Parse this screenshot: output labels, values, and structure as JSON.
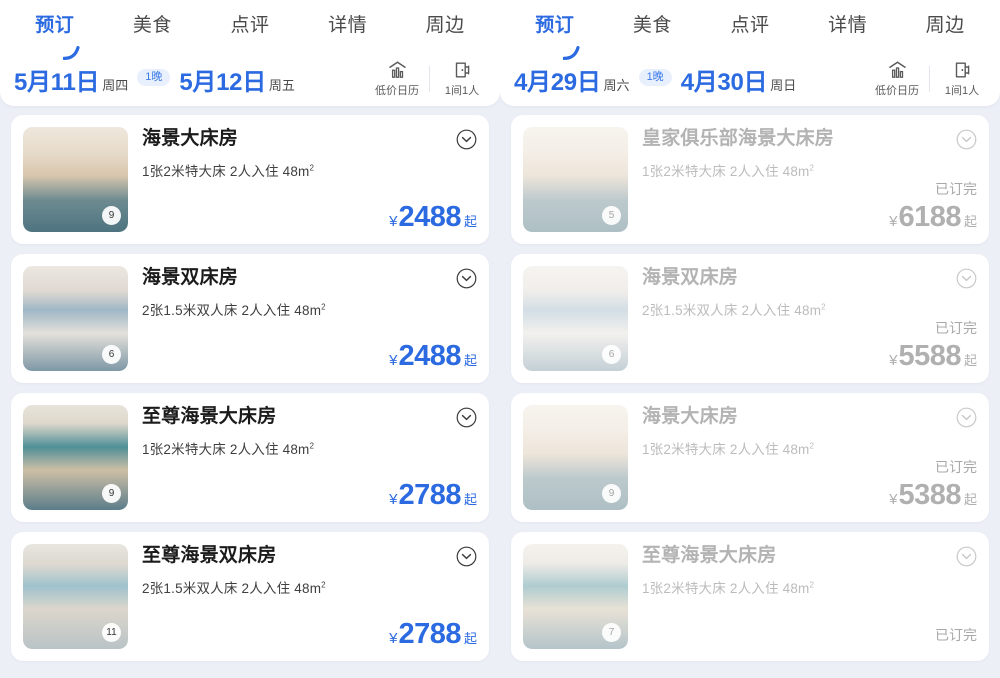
{
  "panels": [
    {
      "id": "left",
      "tabs": [
        {
          "label": "预订",
          "active": true
        },
        {
          "label": "美食",
          "active": false
        },
        {
          "label": "点评",
          "active": false
        },
        {
          "label": "详情",
          "active": false
        },
        {
          "label": "周边",
          "active": false
        }
      ],
      "dates": {
        "checkin_date": "5月11日",
        "checkin_week": "周四",
        "nights": "1晚",
        "checkout_date": "5月12日",
        "checkout_week": "周五"
      },
      "actions": [
        {
          "label": "低价日历",
          "icon": "low-price-calendar-icon"
        },
        {
          "label": "1间1人",
          "icon": "room-guest-icon"
        }
      ],
      "rooms": [
        {
          "name": "海景大床房",
          "attrs": "1张2米特大床  2人入住  48m",
          "attrs_sup": "2",
          "photo_count": "9",
          "currency": "¥",
          "price": "2488",
          "price_suffix": "起",
          "sold_out": false,
          "sold_out_label": "",
          "thumb_style": "suite-warm"
        },
        {
          "name": "海景双床房",
          "attrs": "2张1.5米双人床  2人入住  48m",
          "attrs_sup": "2",
          "photo_count": "6",
          "currency": "¥",
          "price": "2488",
          "price_suffix": "起",
          "sold_out": false,
          "sold_out_label": "",
          "thumb_style": "twin-window"
        },
        {
          "name": "至尊海景大床房",
          "attrs": "1张2米特大床  2人入住  48m",
          "attrs_sup": "2",
          "photo_count": "9",
          "currency": "¥",
          "price": "2788",
          "price_suffix": "起",
          "sold_out": false,
          "sold_out_label": "",
          "thumb_style": "teal-art"
        },
        {
          "name": "至尊海景双床房",
          "attrs": "2张1.5米双人床  2人入住  48m",
          "attrs_sup": "2",
          "photo_count": "11",
          "currency": "¥",
          "price": "2788",
          "price_suffix": "起",
          "sold_out": false,
          "sold_out_label": "",
          "thumb_style": "sea-view"
        }
      ]
    },
    {
      "id": "right",
      "tabs": [
        {
          "label": "预订",
          "active": true
        },
        {
          "label": "美食",
          "active": false
        },
        {
          "label": "点评",
          "active": false
        },
        {
          "label": "详情",
          "active": false
        },
        {
          "label": "周边",
          "active": false
        }
      ],
      "dates": {
        "checkin_date": "4月29日",
        "checkin_week": "周六",
        "nights": "1晚",
        "checkout_date": "4月30日",
        "checkout_week": "周日"
      },
      "actions": [
        {
          "label": "低价日历",
          "icon": "low-price-calendar-icon"
        },
        {
          "label": "1间1人",
          "icon": "room-guest-icon"
        }
      ],
      "rooms": [
        {
          "name": "皇家俱乐部海景大床房",
          "attrs": "1张2米特大床  2人入住  48m",
          "attrs_sup": "2",
          "photo_count": "5",
          "currency": "¥",
          "price": "6188",
          "price_suffix": "起",
          "sold_out": true,
          "sold_out_label": "已订完",
          "thumb_style": "suite-warm"
        },
        {
          "name": "海景双床房",
          "attrs": "2张1.5米双人床  2人入住  48m",
          "attrs_sup": "2",
          "photo_count": "6",
          "currency": "¥",
          "price": "5588",
          "price_suffix": "起",
          "sold_out": true,
          "sold_out_label": "已订完",
          "thumb_style": "twin-window"
        },
        {
          "name": "海景大床房",
          "attrs": "1张2米特大床  2人入住  48m",
          "attrs_sup": "2",
          "photo_count": "9",
          "currency": "¥",
          "price": "5388",
          "price_suffix": "起",
          "sold_out": true,
          "sold_out_label": "已订完",
          "thumb_style": "suite-warm"
        },
        {
          "name": "至尊海景大床房",
          "attrs": "1张2米特大床  2人入住  48m",
          "attrs_sup": "2",
          "photo_count": "7",
          "currency": "¥",
          "price": "",
          "price_suffix": "",
          "sold_out": true,
          "sold_out_label": "已订完",
          "thumb_style": "teal-art"
        }
      ]
    }
  ],
  "colors": {
    "accent": "#2b6ae0",
    "background": "#eceff6",
    "card": "#ffffff",
    "disabled_text": "#b3b3b3",
    "pill_bg": "#e8f0fd"
  }
}
